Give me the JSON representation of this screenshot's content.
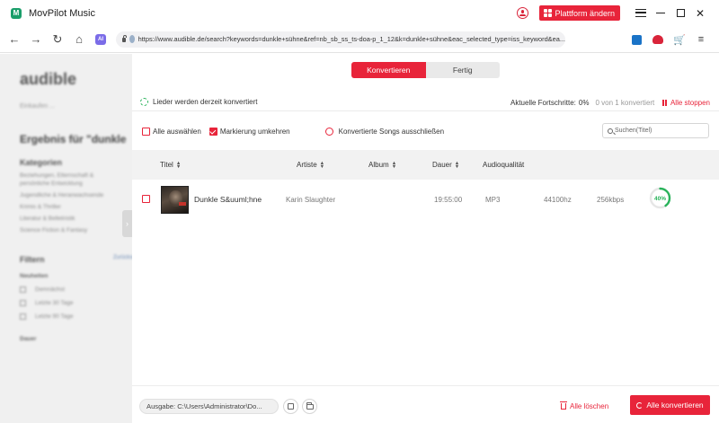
{
  "titlebar": {
    "app_title": "MovPilot Music",
    "platform_button": "Plattform ändern"
  },
  "browser": {
    "url": "https://www.audible.de/search?keywords=dunkle+sühne&ref=nb_sb_ss_ts-doa-p_1_12&k=dunkle+sühne&eac_selected_type=iss_keyword&ea...",
    "ai_badge": "AI"
  },
  "background_page": {
    "logo": "audible",
    "breadcrumb": "Einkaufen ...",
    "heading": "Ergebnis für \"dunkle",
    "categories_heading": "Kategorien",
    "categories": [
      "Beziehungen, Elternschaft &",
      "persönliche Entwicklung",
      "Jugendliche & Heranwachsende",
      "Krimis & Thriller",
      "Literatur & Belletristik",
      "Science Fiction & Fantasy"
    ],
    "filters_heading": "Filtern",
    "filters_link": "Zurücksetzen",
    "new_heading": "Neuheiten",
    "new_options": [
      "Demnächst",
      "Letzte 30 Tage",
      "Letzte 90 Tage"
    ],
    "length_heading": "Dauer"
  },
  "tabs": {
    "convert": "Konvertieren",
    "done": "Fertig"
  },
  "status": {
    "text": "Lieder werden derzeit konvertiert",
    "progress_label": "Aktuelle Fortschritte:",
    "progress_pct": "0%",
    "progress_count": "0 von 1 konvertiert",
    "stop_all": "Alle stoppen"
  },
  "actions": {
    "select_all": "Alle auswählen",
    "invert_selection": "Markierung umkehren",
    "exclude_converted": "Konvertierte Songs ausschließen",
    "search_placeholder": "Suchen(Titel)"
  },
  "table": {
    "headers": {
      "title": "Titel",
      "artist": "Artiste",
      "album": "Album",
      "duration": "Dauer",
      "quality": "Audioqualität"
    },
    "rows": [
      {
        "title": "Dunkle S&uuml;hne",
        "artist": "Karin Slaughter",
        "album": "",
        "duration": "19:55:00",
        "format": "MP3",
        "samplerate": "44100hz",
        "bitrate": "256kbps",
        "progress": "40%",
        "progress_value": 0.4
      }
    ]
  },
  "footer": {
    "output_path": "Ausgabe: C:\\Users\\Administrator\\Do...",
    "delete_all": "Alle löschen",
    "convert_all": "Alle konvertieren"
  },
  "colors": {
    "accent": "#e8243a",
    "progress_green": "#29b35a"
  }
}
